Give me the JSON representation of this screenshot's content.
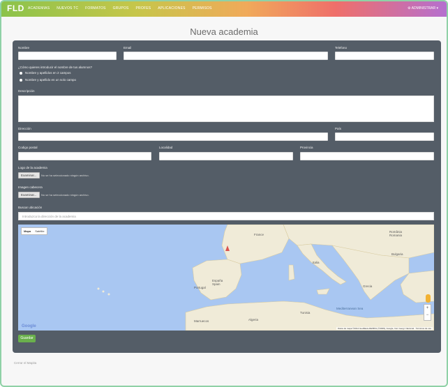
{
  "brand": "FLD",
  "nav": {
    "links": [
      "Academias",
      "Nuevos TC",
      "Formatos",
      "Grupos",
      "Profes",
      "Aplicaciones",
      "Permisos"
    ],
    "user": "Administrar"
  },
  "page": {
    "title": "Nueva academia"
  },
  "form": {
    "nombre_label": "Nombre",
    "email_label": "Email",
    "telefono_label": "Telefono",
    "student_name_question": "¿Cómo quieres introducir el nombre de tus alumnos?",
    "radio_option_1": "Nombre y apellidos en 2 campos",
    "radio_option_2": "Nombre y apellido en un solo campo",
    "descripcion_label": "Descripción",
    "direccion_label": "Dirección",
    "pais_label": "País",
    "codigo_postal_label": "Codigo postal",
    "localidad_label": "Localidad",
    "provincia_label": "Provincia",
    "logo_label": "Logo de la academia",
    "imagen_label": "Imagen cabecera",
    "browse_label": "Examinar...",
    "no_file_text": "No se ha seleccionado ningún archivo.",
    "buscar_label": "Buscar ubicación",
    "search_placeholder": "Introduzca la dirección de la academia",
    "save_label": "Guardar"
  },
  "map": {
    "type_map": "Mapa",
    "type_satellite": "Satélite",
    "places": {
      "france": "France",
      "spain": "España\nSpain",
      "portugal": "Portugal",
      "italy": "Italia",
      "romania": "România\nRomania",
      "bulgaria": "Bulgaria",
      "greece": "Grecia",
      "algeria": "Algeria",
      "tunisia": "Tunisia",
      "morocco": "Marruecos",
      "mediterranean": "Mediterranean Sea"
    },
    "attribution": "Datos de mapa ©2014 GeoBasis-DE/BKG (©2009), Google, Inst. Geogr. Nacional · Términos de uso"
  },
  "footer": {
    "text": "Cerrar el Mapita"
  }
}
